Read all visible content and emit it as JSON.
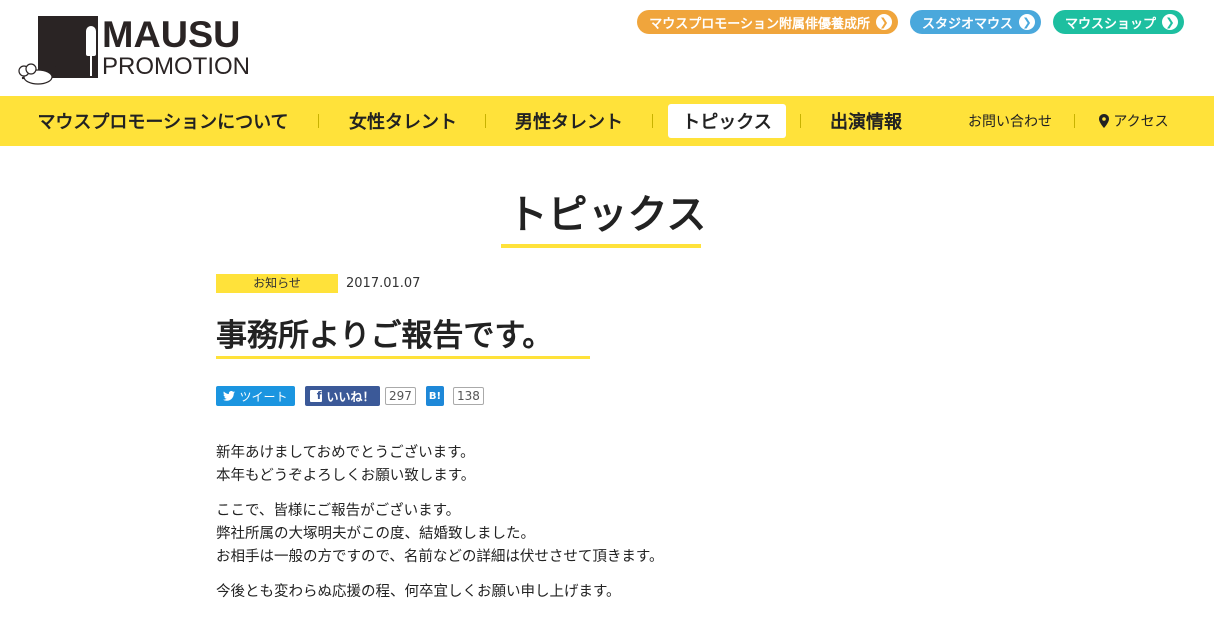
{
  "header": {
    "logo_line1": "MAUSU",
    "logo_line2": "PROMOTION",
    "top_links": [
      {
        "label": "マウスプロモーション附属俳優養成所",
        "color": "#f0a53c"
      },
      {
        "label": "スタジオマウス",
        "color": "#4aa8dc"
      },
      {
        "label": "マウスショップ",
        "color": "#1dbfa0"
      }
    ]
  },
  "nav": {
    "items": [
      {
        "label": "マウスプロモーションについて"
      },
      {
        "label": "女性タレント"
      },
      {
        "label": "男性タレント"
      },
      {
        "label": "トピックス",
        "active": true
      },
      {
        "label": "出演情報"
      },
      {
        "label": "お問い合わせ"
      },
      {
        "label": "アクセス",
        "icon": "map-pin-icon"
      }
    ]
  },
  "page": {
    "title": "トピックス"
  },
  "article": {
    "category": "お知らせ",
    "date": "2017.01.07",
    "title": "事務所よりご報告です。",
    "share": {
      "tweet_label": "ツイート",
      "like_label": "いいね！",
      "like_count": "297",
      "hatena_label": "B!",
      "hatena_count": "138"
    },
    "paragraphs": [
      [
        "新年あけましておめでとうございます。",
        "本年もどうぞよろしくお願い致します。"
      ],
      [
        "ここで、皆様にご報告がございます。",
        "弊社所属の大塚明夫がこの度、結婚致しました。",
        "お相手は一般の方ですので、名前などの詳細は伏せさせて頂きます。"
      ],
      [
        "今後とも変わらぬ応援の程、何卒宜しくお願い申し上げます。"
      ]
    ]
  },
  "colors": {
    "accent": "#ffe23a",
    "twitter": "#1b95e0",
    "facebook": "#3b5998",
    "hatena": "#1e88d8"
  }
}
